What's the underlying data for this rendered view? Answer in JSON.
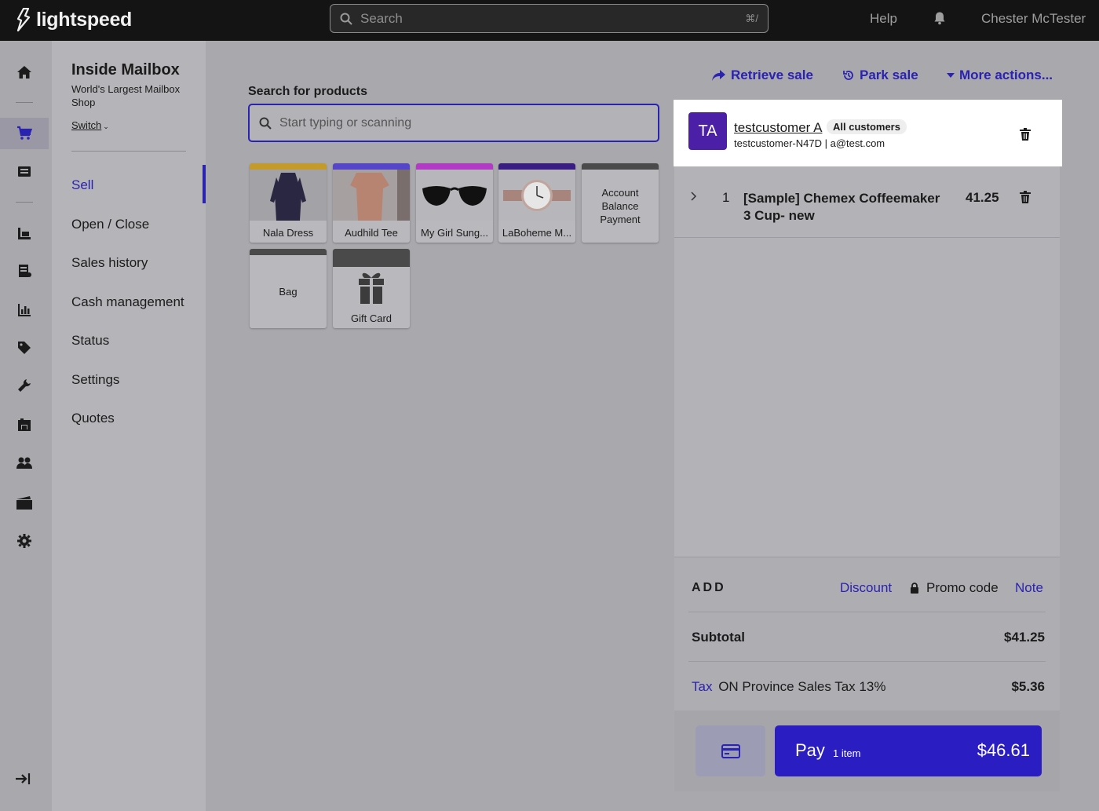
{
  "topbar": {
    "logo_text": "lightspeed",
    "search_placeholder": "Search",
    "search_shortcut": "⌘/",
    "help_label": "Help",
    "user_name": "Chester McTester"
  },
  "rail": {
    "icons": [
      "home-icon",
      "cart-icon",
      "register-icon",
      "inventory-icon",
      "invoice-icon",
      "reports-icon",
      "tag-icon",
      "wrench-icon",
      "warehouse-icon",
      "customers-icon",
      "ecommerce-icon",
      "settings-icon",
      "collapse-icon"
    ]
  },
  "subnav": {
    "store_name": "Inside Mailbox",
    "store_subtitle": "World's Largest Mailbox Shop",
    "switch_label": "Switch",
    "items": [
      {
        "label": "Sell"
      },
      {
        "label": "Open / Close"
      },
      {
        "label": "Sales history"
      },
      {
        "label": "Cash management"
      },
      {
        "label": "Status"
      },
      {
        "label": "Settings"
      },
      {
        "label": "Quotes"
      }
    ]
  },
  "products": {
    "search_label": "Search for products",
    "search_placeholder": "Start typing or scanning",
    "tiles": [
      {
        "name": "Nala Dress",
        "color": "#c49a2a"
      },
      {
        "name": "Audhild Tee",
        "color": "#5546c9"
      },
      {
        "name": "My Girl Sung...",
        "color": "#b13bc4"
      },
      {
        "name": "LaBoheme M...",
        "color": "#3a1d82"
      },
      {
        "name": "Account Balance Payment",
        "color": "#4a4a4a"
      },
      {
        "name": "Bag",
        "color": "#4a4a4a"
      },
      {
        "name": "Gift Card",
        "color": "#4a4a4a"
      }
    ]
  },
  "sale_actions": {
    "retrieve": "Retrieve sale",
    "park": "Park sale",
    "more": "More actions..."
  },
  "customer": {
    "initials": "TA",
    "name": "testcustomer A",
    "group": "All customers",
    "meta": "testcustomer-N47D | a@test.com"
  },
  "line_items": [
    {
      "qty": "1",
      "name": "[Sample] Chemex Coffeemaker 3 Cup- new",
      "price": "41.25"
    }
  ],
  "totals": {
    "add_label": "ADD",
    "discount": "Discount",
    "promo": "Promo code",
    "note": "Note",
    "subtotal_label": "Subtotal",
    "subtotal": "$41.25",
    "tax_link": "Tax",
    "tax_label": "ON Province Sales Tax 13%",
    "tax": "$5.36"
  },
  "pay": {
    "label": "Pay",
    "items": "1 item",
    "total": "$46.61"
  },
  "colors": {
    "accent": "#2a22b0",
    "pay_button": "#2a1ec2",
    "avatar": "#4b1fa6",
    "topbar": "#141414"
  }
}
